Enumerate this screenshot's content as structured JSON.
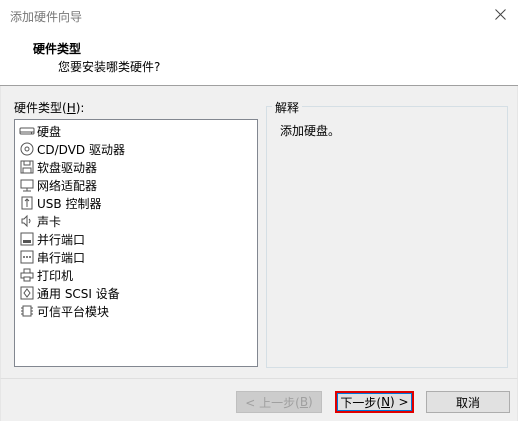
{
  "window": {
    "title": "添加硬件向导"
  },
  "header": {
    "title": "硬件类型",
    "subtitle": "您要安装哪类硬件?"
  },
  "hardware": {
    "label_prefix": "硬件类型(",
    "label_key": "H",
    "label_suffix": "):",
    "items": [
      {
        "label": "硬盘",
        "icon": "hard-disk-icon"
      },
      {
        "label": "CD/DVD 驱动器",
        "icon": "cd-dvd-icon"
      },
      {
        "label": "软盘驱动器",
        "icon": "floppy-icon"
      },
      {
        "label": "网络适配器",
        "icon": "network-adapter-icon"
      },
      {
        "label": "USB 控制器",
        "icon": "usb-icon"
      },
      {
        "label": "声卡",
        "icon": "sound-card-icon"
      },
      {
        "label": "并行端口",
        "icon": "parallel-port-icon"
      },
      {
        "label": "串行端口",
        "icon": "serial-port-icon"
      },
      {
        "label": "打印机",
        "icon": "printer-icon"
      },
      {
        "label": "通用 SCSI 设备",
        "icon": "scsi-device-icon"
      },
      {
        "label": "可信平台模块",
        "icon": "tpm-icon"
      }
    ]
  },
  "explanation": {
    "legend": "解释",
    "text": "添加硬盘。"
  },
  "buttons": {
    "back": {
      "prefix": "< 上一步(",
      "key": "B",
      "suffix": ")"
    },
    "next": {
      "prefix": "下一步(",
      "key": "N",
      "suffix": ") >"
    },
    "cancel": {
      "label": "取消"
    }
  }
}
